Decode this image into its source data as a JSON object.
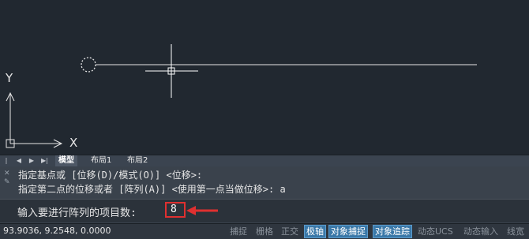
{
  "canvas": {
    "axis_x_label": "X",
    "axis_y_label": "Y"
  },
  "layout_tabs": {
    "nav_icons": [
      "first-icon",
      "prev-icon",
      "next-icon",
      "last-icon"
    ],
    "tabs": [
      "模型",
      "布局1",
      "布局2"
    ],
    "active": "模型"
  },
  "command": {
    "history": [
      "指定基点或 [位移(D)/模式(O)] <位移>:",
      "指定第二点的位移或者 [阵列(A)] <使用第一点当做位移>: a"
    ],
    "prompt": "输入要进行阵列的项目数:",
    "input_value": "8"
  },
  "status": {
    "coordinates": "93.9036, 9.2548, 0.0000",
    "toggles": [
      {
        "label": "捕捉",
        "on": false
      },
      {
        "label": "栅格",
        "on": false
      },
      {
        "label": "正交",
        "on": false
      },
      {
        "label": "极轴",
        "on": true
      },
      {
        "label": "对象捕捉",
        "on": true
      },
      {
        "label": "对象追踪",
        "on": true
      },
      {
        "label": "动态UCS",
        "on": false
      },
      {
        "label": "动态输入",
        "on": false
      },
      {
        "label": "线宽",
        "on": false
      }
    ]
  },
  "colors": {
    "canvas_bg": "#212830",
    "highlight": "#e03030",
    "toggle_on": "#3a78a8"
  }
}
